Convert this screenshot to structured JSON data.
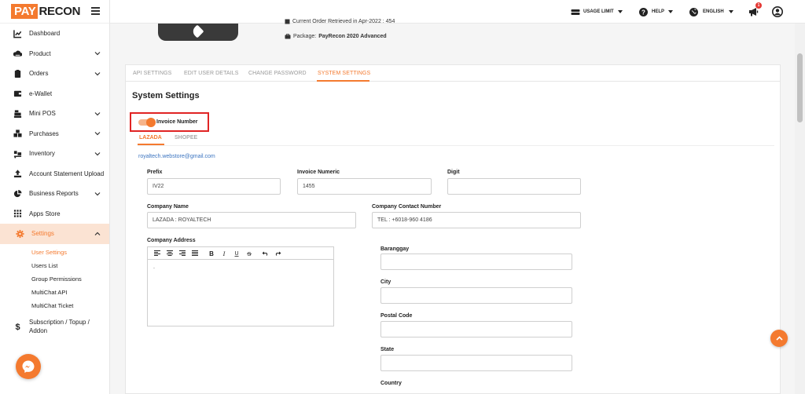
{
  "brand": {
    "logo_left": "PAY",
    "logo_right": "RECON",
    "accent": "#f47a2f"
  },
  "topbar": {
    "usage_limit": "USAGE LIMIT",
    "help": "HELP",
    "language": "ENGLISH",
    "notification_count": "1"
  },
  "sidebar": {
    "items": [
      {
        "label": "Dashboard",
        "icon": "chart-line-icon"
      },
      {
        "label": "Product",
        "icon": "cloud-icon"
      },
      {
        "label": "Orders",
        "icon": "clipboard-icon"
      },
      {
        "label": "e-Wallet",
        "icon": "wallet-icon"
      },
      {
        "label": "Mini POS",
        "icon": "cash-register-icon"
      },
      {
        "label": "Purchases",
        "icon": "boxes-icon"
      },
      {
        "label": "Inventory",
        "icon": "dolly-icon"
      },
      {
        "label": "Account Statement Upload",
        "icon": "upload-icon"
      },
      {
        "label": "Business Reports",
        "icon": "pie-chart-icon"
      },
      {
        "label": "Apps Store",
        "icon": "grid-icon"
      },
      {
        "label": "Settings",
        "icon": "gear-icon"
      }
    ],
    "settings_sub": [
      "User Settings",
      "Users List",
      "Group Permissions",
      "MultiChat API",
      "MultiChat Ticket"
    ],
    "subscription": {
      "line1": "Subscription / Topup /",
      "line2": "Addon",
      "icon": "dollar-icon"
    }
  },
  "profile": {
    "order_line": "Current Order Retrieved in Apr-2022 : 454",
    "package_label": "Package:",
    "package_value": "PayRecon 2020 Advanced"
  },
  "tabs": [
    "API SETTINGS",
    "EDIT USER DETAILS",
    "CHANGE PASSWORD",
    "SYSTEM SETTINGS"
  ],
  "system_settings": {
    "title": "System Settings",
    "toggle_label": "Invoice Number",
    "toggle_on": true,
    "subtabs": [
      "LAZADA",
      "SHOPEE"
    ],
    "email": "royaltech.webstore@gmail.com",
    "fields": {
      "prefix": {
        "label": "Prefix",
        "value": "IV22"
      },
      "invoice_numeric": {
        "label": "Invoice Numeric",
        "value": "1455"
      },
      "digit": {
        "label": "Digit",
        "value": ""
      },
      "company_name": {
        "label": "Company Name",
        "value": "LAZADA : ROYALTECH"
      },
      "company_contact": {
        "label": "Company Contact Number",
        "value": "TEL : +6018-960 4186"
      },
      "company_address": {
        "label": "Company Address",
        "value": "."
      },
      "barangay": {
        "label": "Baranggay",
        "value": ""
      },
      "city": {
        "label": "City",
        "value": ""
      },
      "postal_code": {
        "label": "Postal Code",
        "value": ""
      },
      "state": {
        "label": "State",
        "value": ""
      },
      "country": {
        "label": "Country",
        "value": ""
      }
    }
  }
}
